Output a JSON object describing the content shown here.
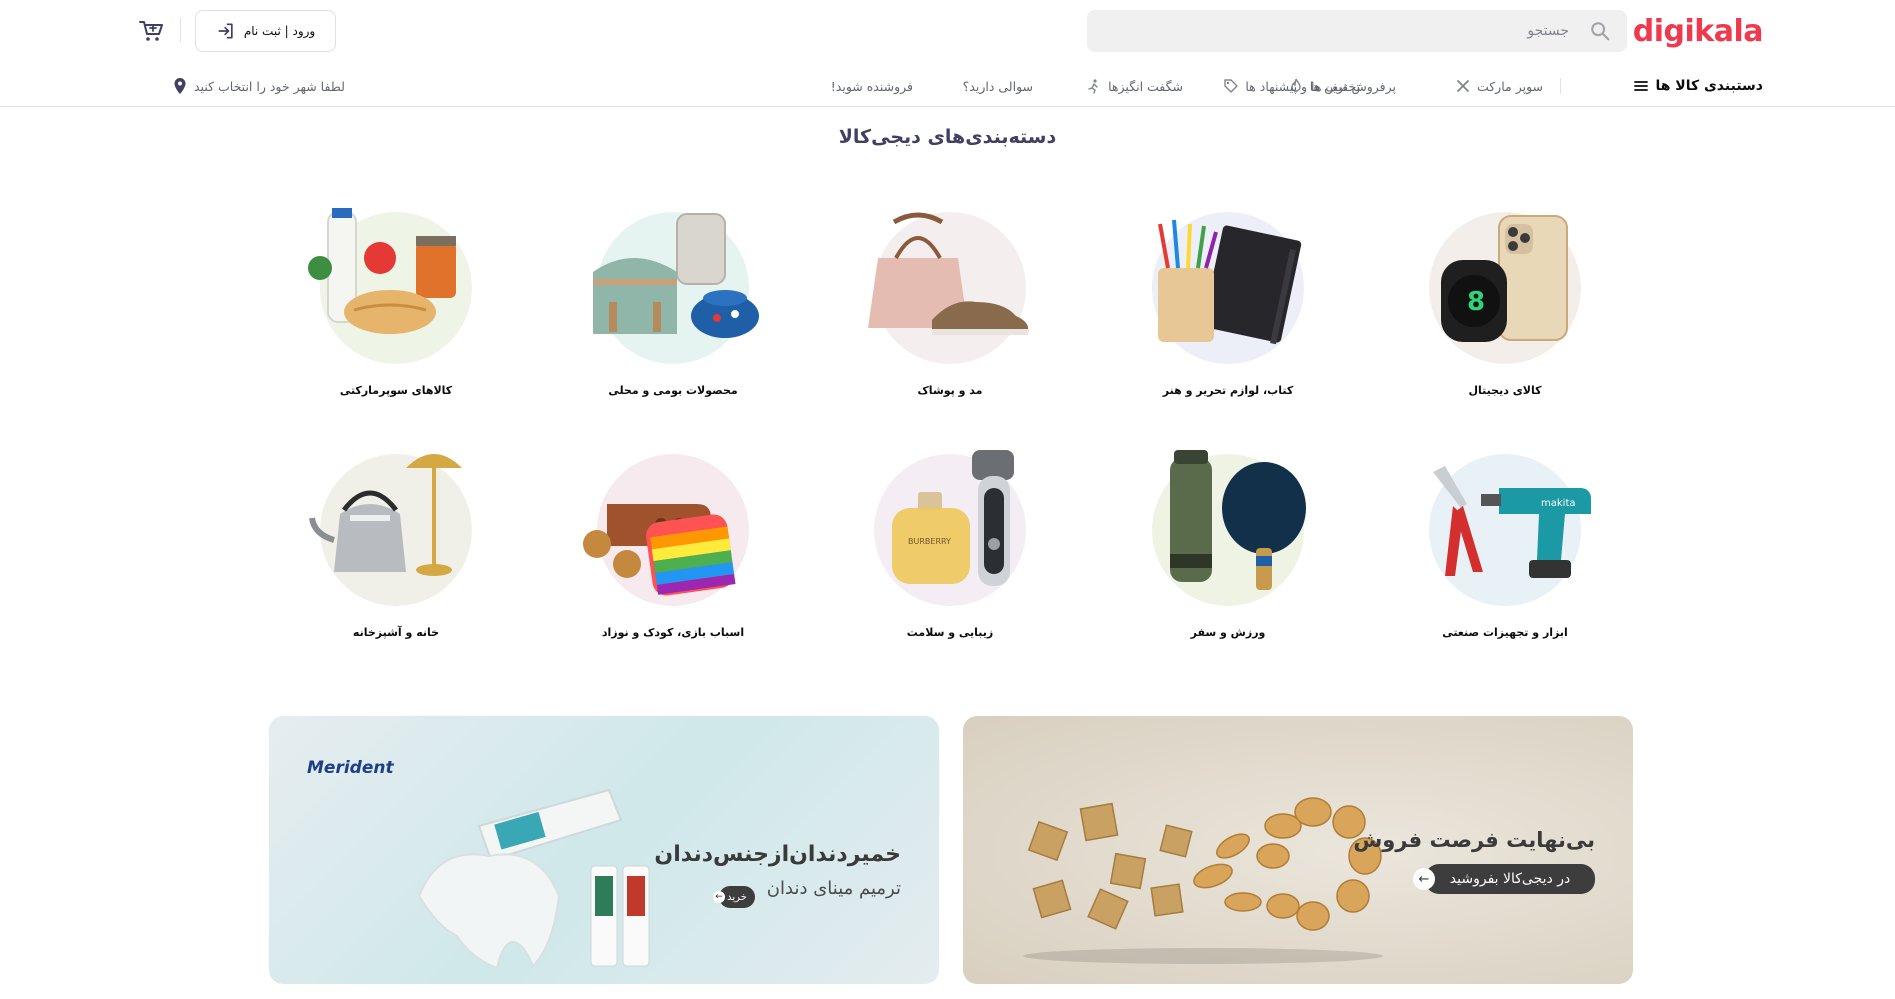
{
  "brand": {
    "logo_text": "digikala",
    "accent": "#ef394e"
  },
  "search": {
    "placeholder": "جستجو",
    "icon": "search-icon"
  },
  "header": {
    "login_label": "ورود | ثبت نام",
    "login_icon": "login-icon",
    "cart_icon": "cart-icon"
  },
  "nav": {
    "categories_label": "دستبندی کالا ها",
    "items": [
      {
        "label": "سوپر مارکت",
        "icon": "supermarket-icon"
      },
      {
        "label": "پرفروش ترین ها",
        "icon": "fire-icon"
      },
      {
        "label": "تخفیف ها و پیشنهاد ها",
        "icon": "tag-icon"
      },
      {
        "label": "شگفت انگیزها",
        "icon": "amazing-icon"
      },
      {
        "label": "سوالی دارید؟",
        "icon": ""
      },
      {
        "label": "فروشنده شوید!",
        "icon": ""
      }
    ],
    "city_label": "لطفا شهر خود را انتخاب کنید",
    "city_icon": "location-pin-icon"
  },
  "section": {
    "title": "دسته‌بندی‌های دیجی‌کالا"
  },
  "categories": [
    {
      "label": "کالای دیجیتال",
      "bg": "#f3eeea"
    },
    {
      "label": "کتاب، لوازم تحریر و هنر",
      "bg": "#eceef8"
    },
    {
      "label": "مد و پوشاک",
      "bg": "#f4efee"
    },
    {
      "label": "محصولات بومی و محلی",
      "bg": "#e6f4f1"
    },
    {
      "label": "کالاهای سوپرمارکتی",
      "bg": "#eef4e6"
    },
    {
      "label": "ابزار و تجهیزات صنعتی",
      "bg": "#e8f2f6"
    },
    {
      "label": "ورزش و سفر",
      "bg": "#eef3e4"
    },
    {
      "label": "زیبایی و سلامت",
      "bg": "#f4eef4"
    },
    {
      "label": "اسباب بازی، کودک و نوزاد",
      "bg": "#f7eaee"
    },
    {
      "label": "خانه و آشپزخانه",
      "bg": "#f1f0e8"
    }
  ],
  "banners": {
    "left": {
      "brand": "Merident",
      "title": "خمیردندان‌ازجنس‌دندان",
      "subtitle": "ترمیم مینای دندان",
      "cta": "خرید"
    },
    "right": {
      "title": "بی‌نهایت فرصت فروش",
      "cta": "در دیجی‌کالا بفروشید"
    }
  }
}
